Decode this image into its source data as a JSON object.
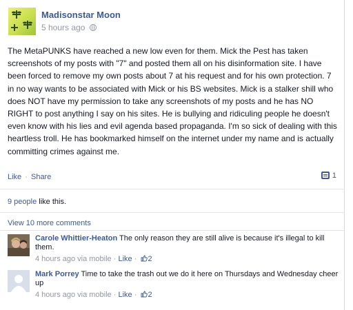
{
  "post": {
    "author": "Madisonstar Moon",
    "timestamp": "5 hours ago",
    "privacy_icon": "globe-icon",
    "body": "The MetaPUNKS have reached a new low even for them. Mick the Pest has taken screenshots of my posts with \"7\" and posted them all on his disinformation site. I have been forced to remove my own posts about 7 at his request and for his own protection. 7 in no way wants to be associated with Mick or his BS websites. Mick is a stalker shill who does NOT have my permission to take any screenshots of my posts and he has NO RIGHT to post anything I say on his sites. He is bullying and ridiculing people he doesn't even know with his lies and evil agenda based propaganda. I'm so sick of dealing with this heartless troll. He has bookmarked himself on the internet under my name and is actually committing crimes against me."
  },
  "actions": {
    "like_label": "Like",
    "separator": "·",
    "share_label": "Share",
    "comment_count": "1"
  },
  "likes": {
    "count_label": "9 people",
    "suffix": " like this."
  },
  "view_more": "View 10 more comments",
  "comments": [
    {
      "name": "Carole Whittier-Heaton",
      "text": " The only reason they are still alive is because it's illegal to kill them.",
      "time": "4 hours ago via mobile",
      "separator": " · ",
      "like_label": "Like",
      "like_count": "2"
    },
    {
      "name": "Mark Porrey",
      "text": " Time to take the trash out we do it here on Thursdays and Wednesday cheer up",
      "time": "4 hours ago via mobile",
      "separator": " · ",
      "like_label": "Like",
      "like_count": "2"
    }
  ],
  "colors": {
    "link": "#3b5998",
    "text": "#141823",
    "muted": "#9197a3",
    "divider": "#e5e5e5"
  }
}
